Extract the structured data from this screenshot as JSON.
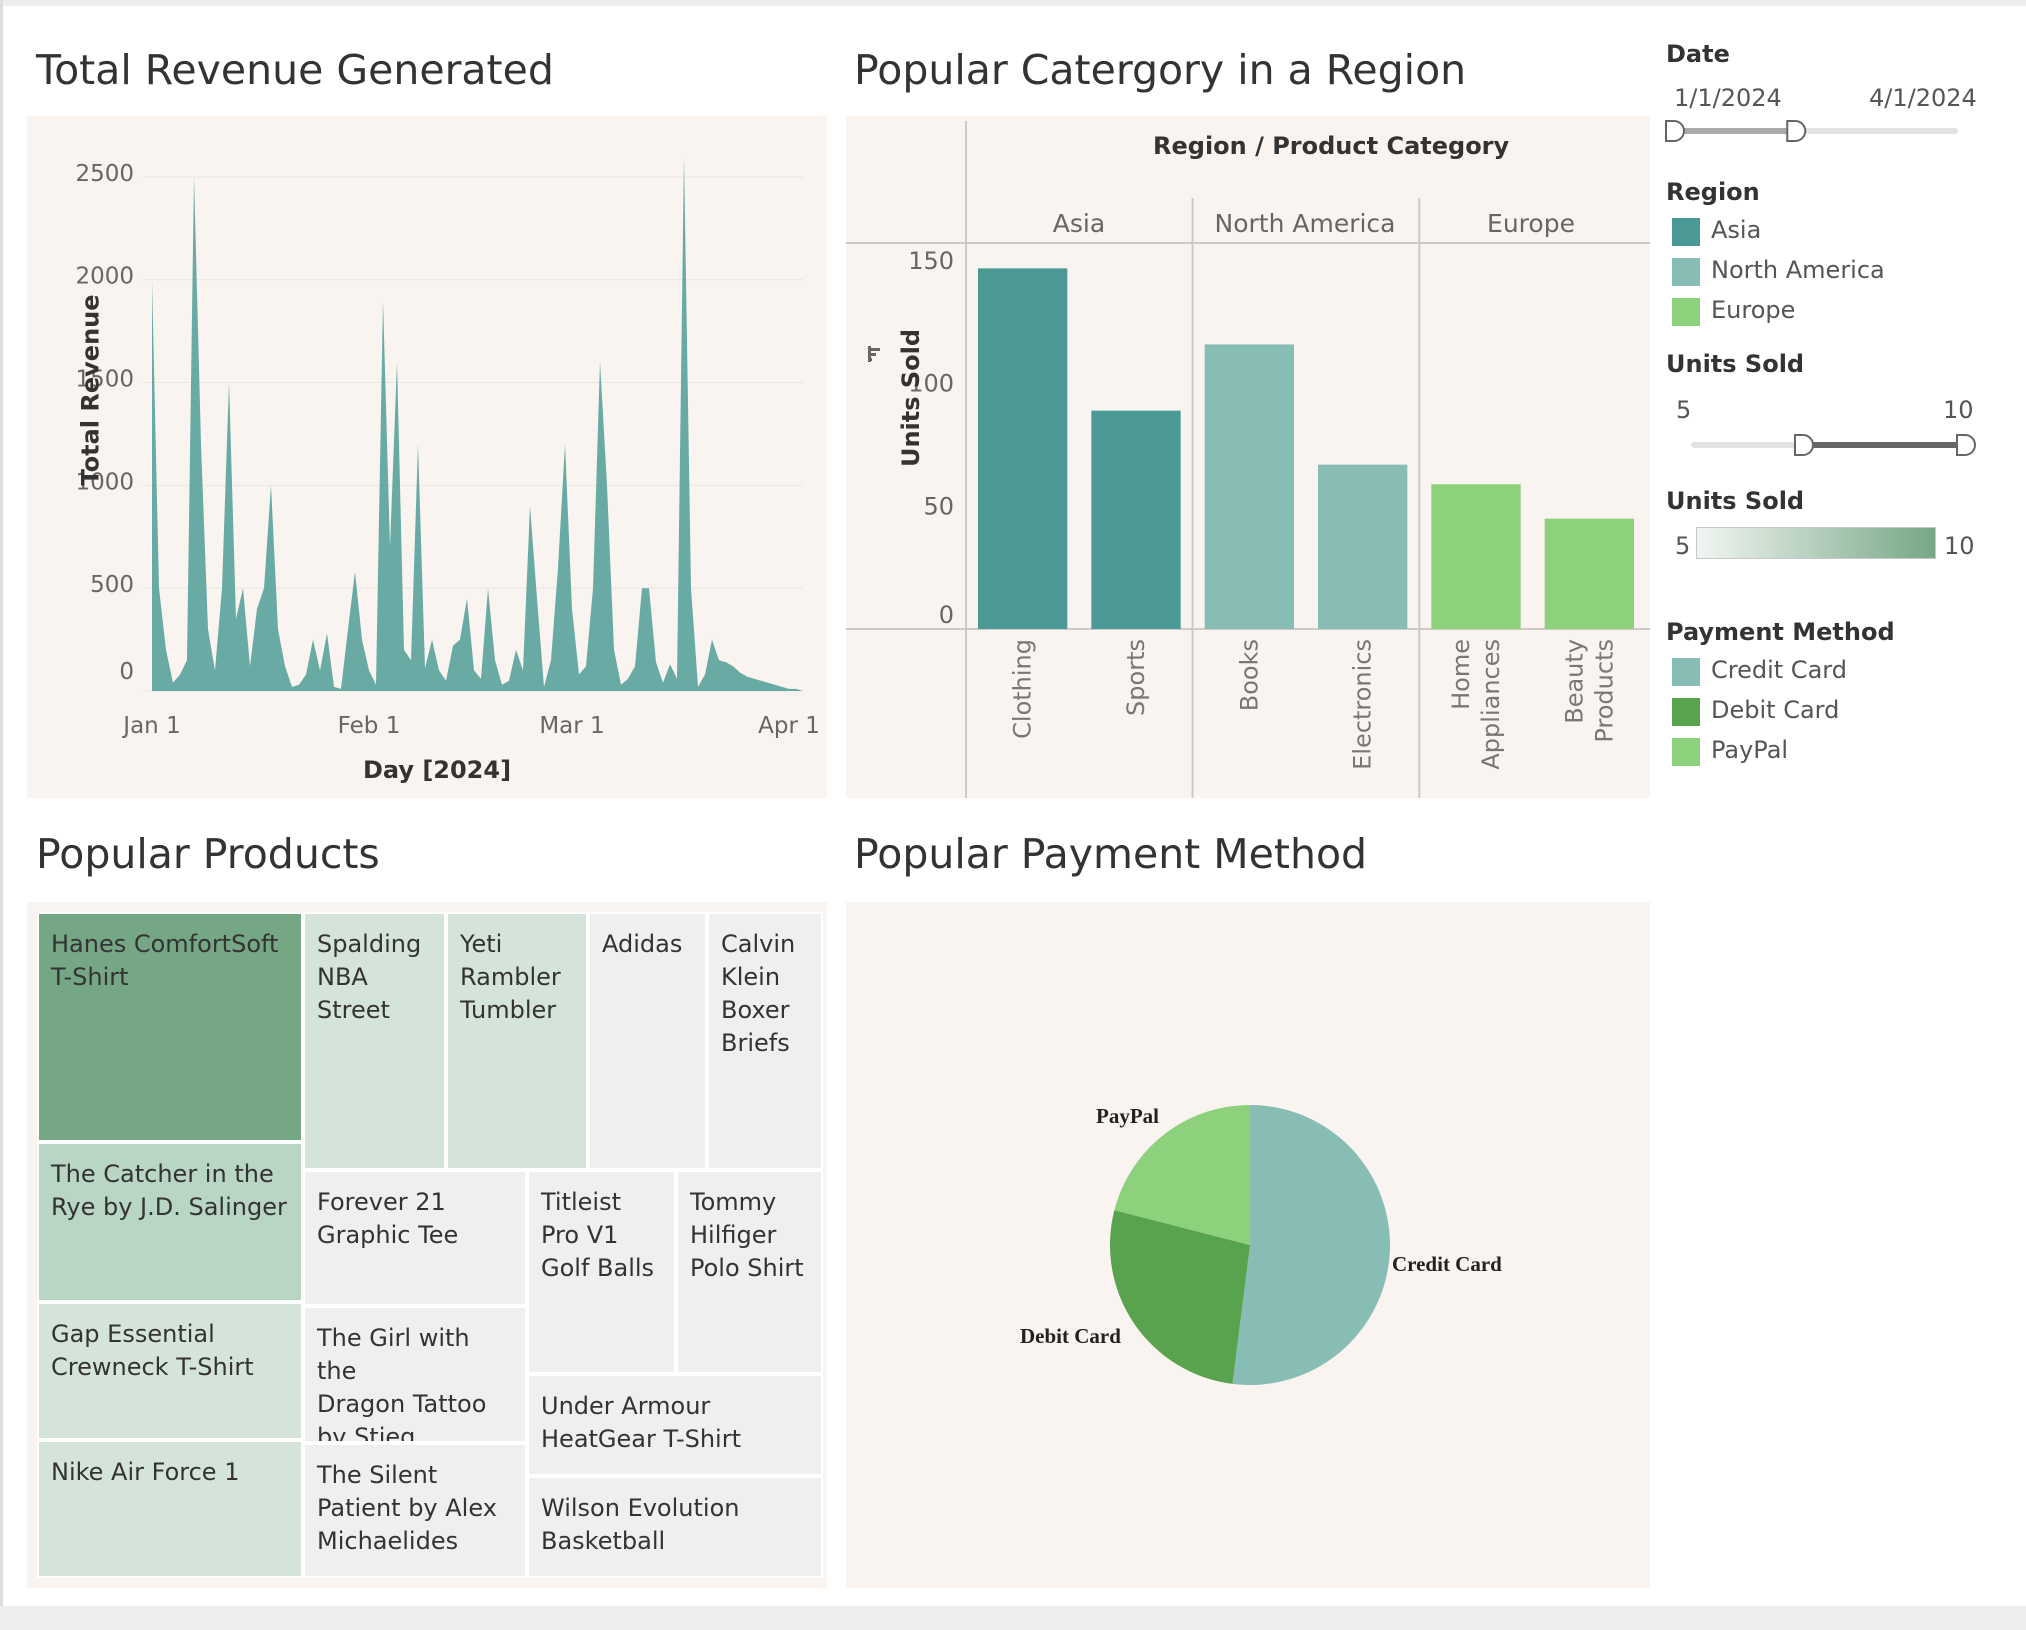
{
  "colors": {
    "panel_bg": "#f9f4f0",
    "area_fill": "#69aaa4",
    "asia": "#4a9994",
    "north_america": "#88bdb5",
    "europe": "#8ed17d",
    "credit_card": "#88bdb5",
    "debit_card": "#59a24e",
    "paypal": "#8ed17d",
    "tile_dark": "#76a785",
    "tile_mid": "#b9d5c3",
    "tile_light": "#d4e4da",
    "tile_grey": "#efefef"
  },
  "revenue": {
    "title": "Total Revenue Generated",
    "chart_data": {
      "type": "area",
      "xlabel": "Day [2024]",
      "ylabel": "Total Revenue",
      "ylim": [
        0,
        2650
      ],
      "y_ticks": [
        "2500",
        "2000",
        "1500",
        "1000",
        "500",
        "0"
      ],
      "x_ticks": [
        "Jan 1",
        "Feb 1",
        "Mar 1",
        "Apr 1"
      ],
      "grid": "horizontal",
      "x_day": [
        0,
        1,
        2,
        3,
        4,
        5,
        6,
        7,
        8,
        9,
        10,
        11,
        12,
        13,
        14,
        15,
        16,
        17,
        18,
        19,
        20,
        21,
        22,
        23,
        24,
        25,
        26,
        27,
        28,
        29,
        30,
        31,
        32,
        33,
        34,
        35,
        36,
        37,
        38,
        39,
        40,
        41,
        42,
        43,
        44,
        45,
        46,
        47,
        48,
        49,
        50,
        51,
        52,
        53,
        54,
        55,
        56,
        57,
        58,
        59,
        60,
        61,
        62,
        63,
        64,
        65,
        66,
        67,
        68,
        69,
        70,
        71,
        72,
        73,
        74,
        75,
        76,
        77,
        78,
        79,
        80,
        81,
        82,
        83,
        84,
        85,
        86,
        87,
        88,
        89,
        90,
        91,
        92,
        93
      ],
      "values": [
        2000,
        500,
        200,
        40,
        80,
        150,
        2500,
        1200,
        300,
        100,
        500,
        1500,
        350,
        500,
        120,
        400,
        500,
        1000,
        300,
        120,
        20,
        30,
        80,
        250,
        100,
        280,
        20,
        10,
        300,
        580,
        250,
        100,
        30,
        1900,
        700,
        1600,
        200,
        150,
        1200,
        110,
        250,
        100,
        50,
        220,
        250,
        450,
        100,
        60,
        500,
        150,
        30,
        50,
        200,
        100,
        900,
        450,
        20,
        150,
        600,
        1200,
        400,
        80,
        120,
        500,
        1600,
        1000,
        200,
        30,
        60,
        120,
        500,
        500,
        140,
        40,
        130,
        60,
        2600,
        500,
        20,
        80,
        250,
        150,
        140,
        120,
        90,
        70,
        60,
        50,
        40,
        30,
        20,
        10,
        10,
        0
      ]
    }
  },
  "category": {
    "title": "Popular Catergory in a Region",
    "header": "Region  /  Product Category",
    "regions": [
      "Asia",
      "North America",
      "Europe"
    ],
    "chart_data": {
      "type": "bar",
      "ylabel": "Units Sold",
      "ylim": [
        0,
        155
      ],
      "y_ticks": [
        "150",
        "100",
        "50",
        "0"
      ],
      "categories": [
        "Clothing",
        "Sports",
        "Books",
        "Electronics",
        "Home Appliances",
        "Beauty Products"
      ],
      "category_lines": [
        [
          "Clothing"
        ],
        [
          "Sports"
        ],
        [
          "Books"
        ],
        [
          "Electronics"
        ],
        [
          "Home",
          "Appliances"
        ],
        [
          "Beauty",
          "Products"
        ]
      ],
      "region_of": [
        "Asia",
        "Asia",
        "North America",
        "North America",
        "Europe",
        "Europe"
      ],
      "values": [
        147,
        89,
        116,
        67,
        59,
        45
      ]
    }
  },
  "products": {
    "title": "Popular Products",
    "tiles": [
      {
        "lines": [
          "Hanes ComfortSoft",
          "T-Shirt"
        ],
        "shade": "tile_dark"
      },
      {
        "lines": [
          "The Catcher in the",
          "Rye by J.D. Salinger"
        ],
        "shade": "tile_mid"
      },
      {
        "lines": [
          "Gap Essential",
          "Crewneck T-Shirt"
        ],
        "shade": "tile_light"
      },
      {
        "lines": [
          "Nike Air Force 1"
        ],
        "shade": "tile_light"
      },
      {
        "lines": [
          "Spalding",
          "NBA",
          "Street"
        ],
        "shade": "tile_light"
      },
      {
        "lines": [
          "Yeti",
          "Rambler",
          "Tumbler"
        ],
        "shade": "tile_light"
      },
      {
        "lines": [
          "Adidas"
        ],
        "shade": "tile_grey"
      },
      {
        "lines": [
          "Calvin",
          "Klein",
          "Boxer",
          "Briefs"
        ],
        "shade": "tile_grey"
      },
      {
        "lines": [
          "Forever 21",
          "Graphic Tee"
        ],
        "shade": "tile_grey"
      },
      {
        "lines": [
          "Titleist",
          "Pro V1",
          "Golf Balls"
        ],
        "shade": "tile_grey"
      },
      {
        "lines": [
          "Tommy",
          "Hilfiger",
          "Polo Shirt"
        ],
        "shade": "tile_grey"
      },
      {
        "lines": [
          "The Girl with the",
          "Dragon Tattoo",
          "by Stieg Larsson"
        ],
        "shade": "tile_grey"
      },
      {
        "lines": [
          "Under Armour",
          "HeatGear T-Shirt"
        ],
        "shade": "tile_grey"
      },
      {
        "lines": [
          "The Silent",
          "Patient by Alex",
          "Michaelides"
        ],
        "shade": "tile_grey"
      },
      {
        "lines": [
          "Wilson Evolution",
          "Basketball"
        ],
        "shade": "tile_grey"
      }
    ]
  },
  "payment": {
    "title": "Popular Payment Method",
    "chart_data": {
      "type": "pie",
      "categories": [
        "Credit Card",
        "Debit Card",
        "PayPal"
      ],
      "values": [
        52,
        27,
        21
      ]
    }
  },
  "filters": {
    "date": {
      "title": "Date",
      "start": "1/1/2024",
      "end": "4/1/2024",
      "range_fraction": [
        0.0,
        0.43
      ]
    },
    "region": {
      "title": "Region",
      "items": [
        "Asia",
        "North America",
        "Europe"
      ]
    },
    "units_slider": {
      "title": "Units Sold",
      "min": "5",
      "max": "10",
      "range_fraction": [
        0.4,
        1.0
      ]
    },
    "units_color": {
      "title": "Units Sold",
      "min": "5",
      "max": "10"
    },
    "payment": {
      "title": "Payment Method",
      "items": [
        "Credit Card",
        "Debit Card",
        "PayPal"
      ]
    }
  }
}
